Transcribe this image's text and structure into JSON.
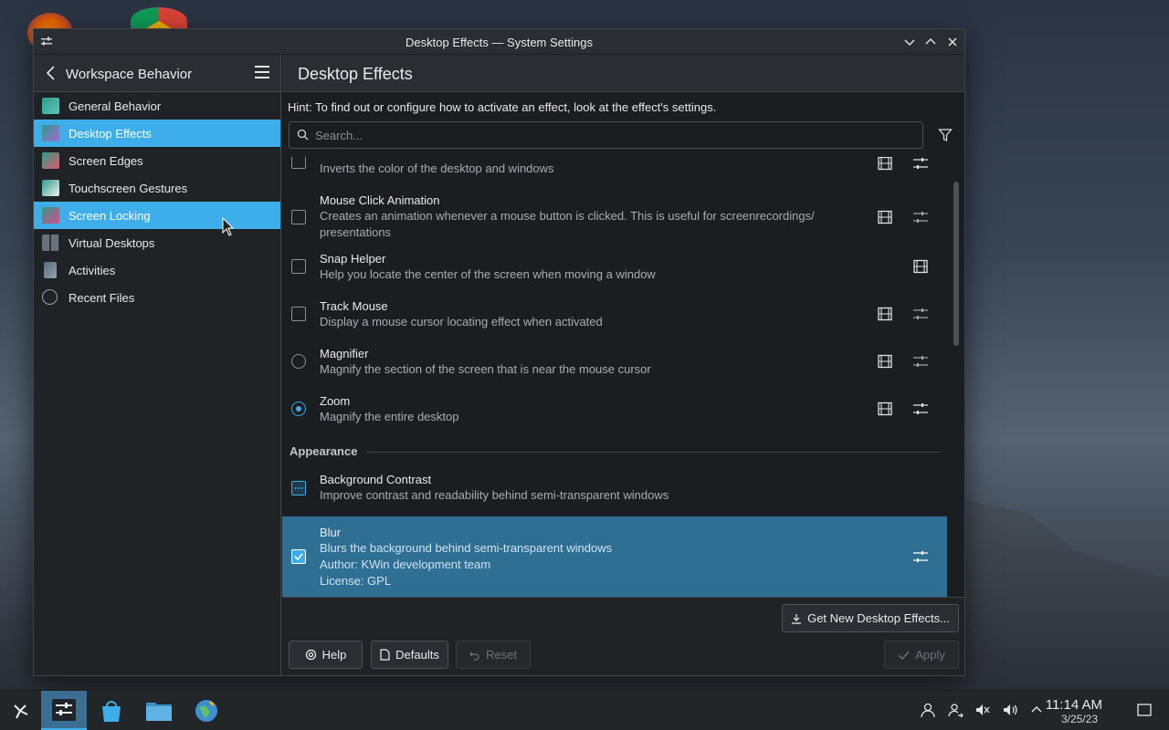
{
  "window": {
    "title": "Desktop Effects — System Settings",
    "controls": [
      "minimize",
      "maximize",
      "close"
    ]
  },
  "sidebar": {
    "back_label": "Workspace Behavior",
    "items": [
      {
        "label": "General Behavior",
        "icon": "general-behavior-icon",
        "state": "normal"
      },
      {
        "label": "Desktop Effects",
        "icon": "desktop-effects-icon",
        "state": "active"
      },
      {
        "label": "Screen Edges",
        "icon": "screen-edges-icon",
        "state": "normal"
      },
      {
        "label": "Touchscreen Gestures",
        "icon": "touchscreen-gestures-icon",
        "state": "normal"
      },
      {
        "label": "Screen Locking",
        "icon": "screen-locking-icon",
        "state": "hover"
      },
      {
        "label": "Virtual Desktops",
        "icon": "virtual-desktops-icon",
        "state": "normal"
      },
      {
        "label": "Activities",
        "icon": "activities-icon",
        "state": "normal"
      },
      {
        "label": "Recent Files",
        "icon": "recent-files-icon",
        "state": "normal"
      }
    ]
  },
  "main": {
    "title": "Desktop Effects",
    "hint": "Hint: To find out or configure how to activate an effect, look at the effect's settings.",
    "search_placeholder": "Search...",
    "effects": [
      {
        "name": "",
        "desc": "Inverts the color of the desktop and windows",
        "control": "checkbox",
        "checked": false,
        "video": true,
        "configure": true
      },
      {
        "name": "Mouse Click Animation",
        "desc": "Creates an animation whenever a mouse button is clicked. This is useful for screenrecordings/",
        "desc2": "presentations",
        "control": "checkbox",
        "checked": false,
        "video": true,
        "configure": true
      },
      {
        "name": "Snap Helper",
        "desc": "Help you locate the center of the screen when moving a window",
        "control": "checkbox",
        "checked": false,
        "video": true,
        "configure": false
      },
      {
        "name": "Track Mouse",
        "desc": "Display a mouse cursor locating effect when activated",
        "control": "checkbox",
        "checked": false,
        "video": true,
        "configure": true
      },
      {
        "name": "Magnifier",
        "desc": "Magnify the section of the screen that is near the mouse cursor",
        "control": "radio",
        "checked": false,
        "video": true,
        "configure": true
      },
      {
        "name": "Zoom",
        "desc": "Magnify the entire desktop",
        "control": "radio",
        "checked": true,
        "video": true,
        "configure": true
      }
    ],
    "section_appearance": "Appearance",
    "appearance_effects": [
      {
        "name": "Background Contrast",
        "desc": "Improve contrast and readability behind semi-transparent windows",
        "control": "checkbox",
        "state": "partial"
      },
      {
        "name": "Blur",
        "desc": "Blurs the background behind semi-transparent windows",
        "author": "Author: KWin development team",
        "license": "License: GPL",
        "control": "checkbox",
        "state": "checked",
        "selected": true
      }
    ]
  },
  "buttons": {
    "get_new": "Get New Desktop Effects...",
    "help": "Help",
    "defaults": "Defaults",
    "reset": "Reset",
    "apply": "Apply"
  },
  "taskbar": {
    "time": "11:14 AM",
    "date": "3/25/23",
    "apps": [
      "application-launcher-icon",
      "system-settings-icon",
      "discover-icon",
      "file-manager-icon",
      "browser-icon"
    ]
  },
  "colors": {
    "accent": "#3daee9",
    "selected_row": "#2f6f94",
    "window_bg": "#202326",
    "list_bg": "#1b1e20"
  }
}
